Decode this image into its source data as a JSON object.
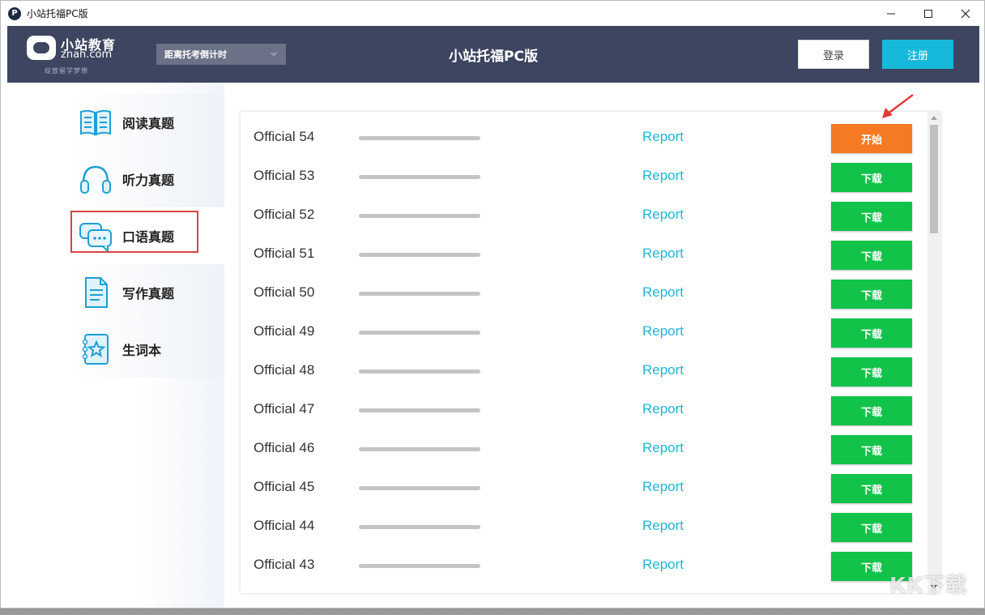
{
  "window": {
    "title": "小站托福PC版",
    "app_icon_letter": "P",
    "controls": {
      "minimize": "—",
      "maximize": "☐",
      "close": "✕"
    }
  },
  "header": {
    "logo_cn": "小站教育",
    "logo_en": "znan.com",
    "logo_slogan": "绽放留学梦想",
    "countdown_label": "距离托考倒计时",
    "title": "小站托福PC版",
    "login_label": "登录",
    "register_label": "注册"
  },
  "sidebar": {
    "items": [
      {
        "label": "阅读真题",
        "icon": "book-icon"
      },
      {
        "label": "听力真题",
        "icon": "headphones-icon"
      },
      {
        "label": "口语真题",
        "icon": "chat-bubbles-icon",
        "active": true
      },
      {
        "label": "写作真题",
        "icon": "document-icon"
      },
      {
        "label": "生词本",
        "icon": "star-notebook-icon"
      }
    ]
  },
  "tests": [
    {
      "name": "Official 54",
      "report": "Report",
      "action": "开始",
      "state": "start"
    },
    {
      "name": "Official 53",
      "report": "Report",
      "action": "下载",
      "state": "download"
    },
    {
      "name": "Official 52",
      "report": "Report",
      "action": "下载",
      "state": "download"
    },
    {
      "name": "Official 51",
      "report": "Report",
      "action": "下载",
      "state": "download"
    },
    {
      "name": "Official 50",
      "report": "Report",
      "action": "下载",
      "state": "download"
    },
    {
      "name": "Official 49",
      "report": "Report",
      "action": "下载",
      "state": "download"
    },
    {
      "name": "Official 48",
      "report": "Report",
      "action": "下载",
      "state": "download"
    },
    {
      "name": "Official 47",
      "report": "Report",
      "action": "下载",
      "state": "download"
    },
    {
      "name": "Official 46",
      "report": "Report",
      "action": "下载",
      "state": "download"
    },
    {
      "name": "Official 45",
      "report": "Report",
      "action": "下载",
      "state": "download"
    },
    {
      "name": "Official 44",
      "report": "Report",
      "action": "下载",
      "state": "download"
    },
    {
      "name": "Official 43",
      "report": "Report",
      "action": "下载",
      "state": "download"
    }
  ],
  "colors": {
    "header_bg": "#3d4560",
    "register_btn": "#16b9d9",
    "report_link": "#1eb7d2",
    "start_btn": "#f57a23",
    "download_btn": "#12c34a",
    "active_frame": "#d64545"
  },
  "watermark": "KK下载"
}
